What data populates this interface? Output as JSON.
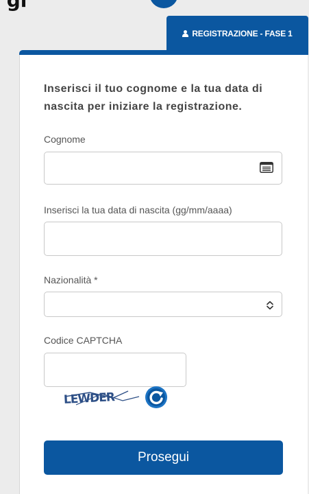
{
  "header": {
    "page_heading_fragment": "gi",
    "tab_label": "REGISTRAZIONE - FASE 1",
    "tab_icon": "user-icon"
  },
  "form": {
    "intro": "Inserisci il tuo cognome e la tua data di nascita per iniziare la registrazione.",
    "surname": {
      "label": "Cognome",
      "value": "",
      "icon": "contact-card-icon"
    },
    "birthdate": {
      "label": "Inserisci la tua data di nascita (gg/mm/aaaa)",
      "value": ""
    },
    "nationality": {
      "label": "Nazionalità *",
      "value": "",
      "icon": "chevron-updown-icon"
    },
    "captcha": {
      "label": "Codice CAPTCHA",
      "value": "",
      "image_text": "LEWDER",
      "refresh_icon": "refresh-icon"
    },
    "submit_label": "Prosegui"
  },
  "colors": {
    "primary": "#0b57a0",
    "background": "#ececec",
    "card": "#ffffff"
  }
}
